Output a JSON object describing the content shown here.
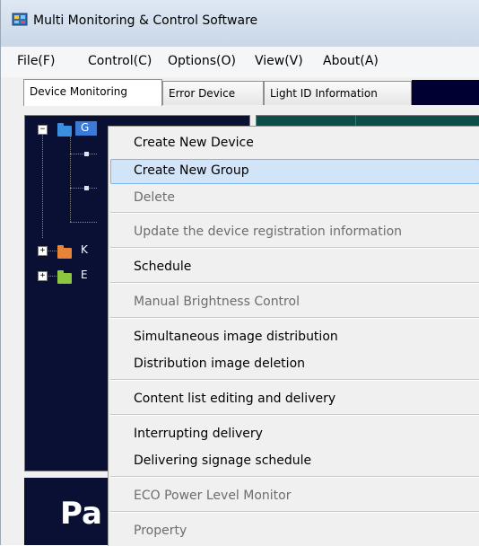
{
  "window": {
    "title": "Multi Monitoring & Control Software"
  },
  "menu": [
    "File(F)",
    "Control(C)",
    "Options(O)",
    "View(V)",
    "About(A)"
  ],
  "tabs": [
    {
      "label": "Device Monitoring",
      "active": true
    },
    {
      "label": "Error Device",
      "active": false
    },
    {
      "label": "Light ID Information",
      "active": false
    }
  ],
  "tree": {
    "items": [
      "G",
      "K",
      "E"
    ]
  },
  "logo": {
    "text": "Pa"
  },
  "context_menu": {
    "items": [
      {
        "label": "Create New Device",
        "enabled": true
      },
      {
        "label": "Create New Group",
        "enabled": true,
        "highlighted": true
      },
      {
        "label": "Delete",
        "enabled": false
      },
      {
        "label": "Update the device registration information",
        "enabled": false
      },
      {
        "label": "Schedule",
        "enabled": true
      },
      {
        "label": "Manual Brightness Control",
        "enabled": false
      },
      {
        "label": "Simultaneous image distribution",
        "enabled": true
      },
      {
        "label": "Distribution image deletion",
        "enabled": true
      },
      {
        "label": "Content list editing and delivery",
        "enabled": true
      },
      {
        "label": "Interrupting delivery",
        "enabled": true
      },
      {
        "label": "Delivering signage schedule",
        "enabled": true
      },
      {
        "label": "ECO Power Level Monitor",
        "enabled": false
      },
      {
        "label": "Property",
        "enabled": false
      }
    ]
  },
  "colors": {
    "tree_background": "#0a1033",
    "highlight": "#d2e4f8",
    "folder_blue": "#3a8ee0",
    "folder_orange": "#e8843a",
    "folder_green": "#8cc63e"
  },
  "icons": {
    "app": "monitor-grid-icon",
    "folder": "folder-icon",
    "expand": "plus-box-icon",
    "collapse": "minus-box-icon"
  }
}
